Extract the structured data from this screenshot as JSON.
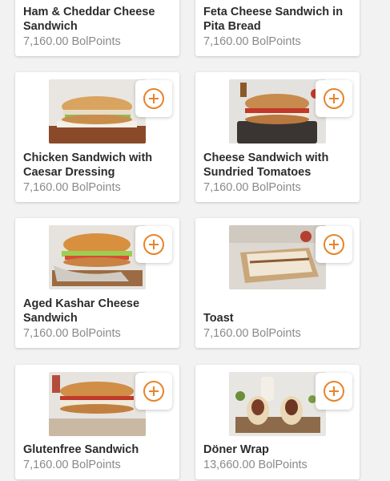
{
  "currency": "BolPoints",
  "products": [
    {
      "name": "Ham & Cheddar Cheese Sandwich",
      "price": "7,160.00 BolPoints",
      "add_icon": "plus-circle-icon"
    },
    {
      "name": "Feta Cheese Sandwich in Pita Bread",
      "price": "7,160.00 BolPoints",
      "add_icon": "plus-circle-icon"
    },
    {
      "name": "Chicken Sandwich with Caesar Dressing",
      "price": "7,160.00 BolPoints",
      "add_icon": "plus-circle-icon"
    },
    {
      "name": "Cheese Sandwich with Sundried Tomatoes",
      "price": "7,160.00 BolPoints",
      "add_icon": "plus-circle-icon"
    },
    {
      "name": "Aged Kashar Cheese Sandwich",
      "price": "7,160.00 BolPoints",
      "add_icon": "plus-circle-icon"
    },
    {
      "name": "Toast",
      "price": "7,160.00 BolPoints",
      "add_icon": "plus-circle-icon"
    },
    {
      "name": "Glutenfree Sandwich",
      "price": "7,160.00 BolPoints",
      "add_icon": "plus-circle-icon"
    },
    {
      "name": "Döner Wrap",
      "price": "13,660.00 BolPoints",
      "add_icon": "plus-circle-icon"
    }
  ],
  "colors": {
    "accent": "#e8832a",
    "name_text": "#2c2c2c",
    "price_text": "#8a8a8a",
    "background": "#f2f2f2"
  }
}
